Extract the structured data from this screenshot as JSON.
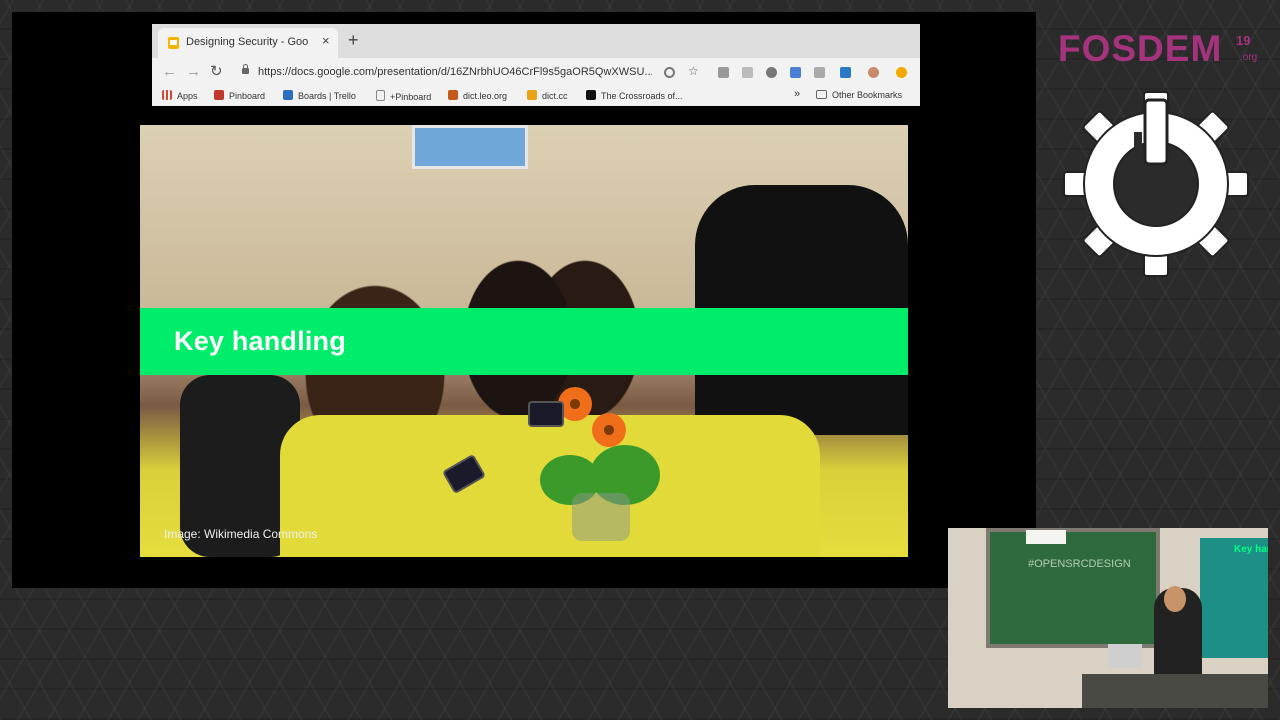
{
  "browser": {
    "tab_title": "Designing Security - Google S",
    "tab_close": "×",
    "new_tab": "+",
    "url": "https://docs.google.com/presentation/d/16ZNrbhUO46CrFl9s5gaOR5QwXWSU...",
    "nav": {
      "back": "←",
      "forward": "→",
      "reload": "↻"
    },
    "bookmarks": [
      {
        "label": "Apps",
        "color": "#d44638"
      },
      {
        "label": "Pinboard",
        "color": "#c0392b"
      },
      {
        "label": "Boards | Trello",
        "color": "#2b6dbf"
      },
      {
        "label": "+Pinboard",
        "color": "#9e9e9e"
      },
      {
        "label": "dict.leo.org",
        "color": "#c45a1a"
      },
      {
        "label": "dict.cc",
        "color": "#e8a317"
      },
      {
        "label": "The Crossroads of...",
        "color": "#111111"
      }
    ],
    "more_bookmarks": "»",
    "other_bookmarks": "Other Bookmarks"
  },
  "slide": {
    "heading": "Key handling",
    "credit": "Image: Wikimedia Commons",
    "banner_color": "#00ed6c"
  },
  "branding": {
    "name": "FOSDEM",
    "year": "19",
    "suffix": ".org",
    "color": "#a6337d"
  },
  "camera": {
    "board_text": "#OPENSRCDESIGN",
    "screen_text": "Key han"
  }
}
